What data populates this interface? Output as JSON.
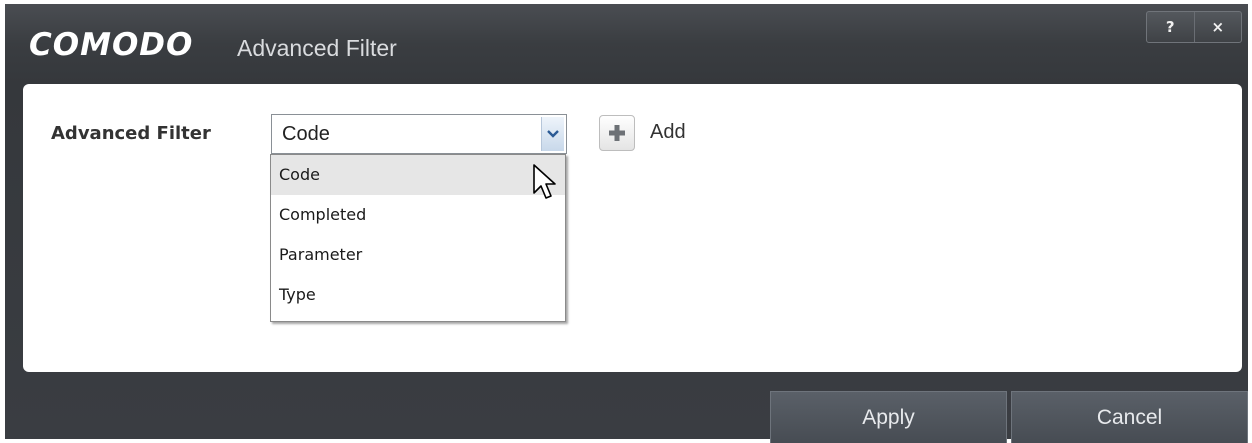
{
  "window": {
    "brand": "COMODO",
    "title": "Advanced Filter",
    "help_label": "?",
    "close_label": "×"
  },
  "filter": {
    "label": "Advanced Filter",
    "selected_value": "Code",
    "options": [
      "Code",
      "Completed",
      "Parameter",
      "Type"
    ],
    "hovered_option": "Code"
  },
  "add_button": {
    "icon": "plus-icon",
    "label": "Add"
  },
  "footer": {
    "apply_label": "Apply",
    "cancel_label": "Cancel"
  },
  "colors": {
    "plus": "#6d7176",
    "dropdown_arrow": "#2b5a95",
    "titlebar": "#3a3d41"
  }
}
